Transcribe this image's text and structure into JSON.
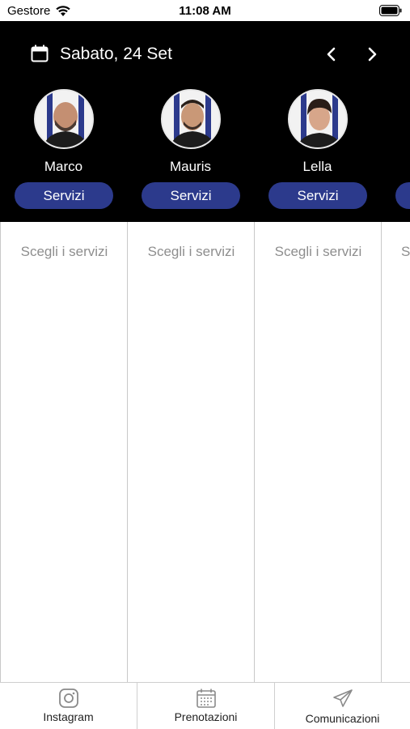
{
  "status_bar": {
    "carrier": "Gestore",
    "time": "11:08 AM"
  },
  "header": {
    "date": "Sabato, 24 Set"
  },
  "staff": [
    {
      "name": "Marco",
      "button": "Servizi"
    },
    {
      "name": "Mauris",
      "button": "Servizi"
    },
    {
      "name": "Lella",
      "button": "Servizi"
    }
  ],
  "columns": {
    "placeholder": "Scegli i servizi",
    "partial_placeholder": "Sc"
  },
  "tab_bar": {
    "items": [
      {
        "label": "Instagram",
        "icon": "instagram-icon"
      },
      {
        "label": "Prenotazioni",
        "icon": "calendar-grid-icon"
      },
      {
        "label": "Comunicazioni",
        "icon": "paper-plane-icon"
      }
    ]
  },
  "colors": {
    "header_bg": "#000000",
    "accent": "#2c3a8c",
    "placeholder_text": "#8e8e8e"
  }
}
